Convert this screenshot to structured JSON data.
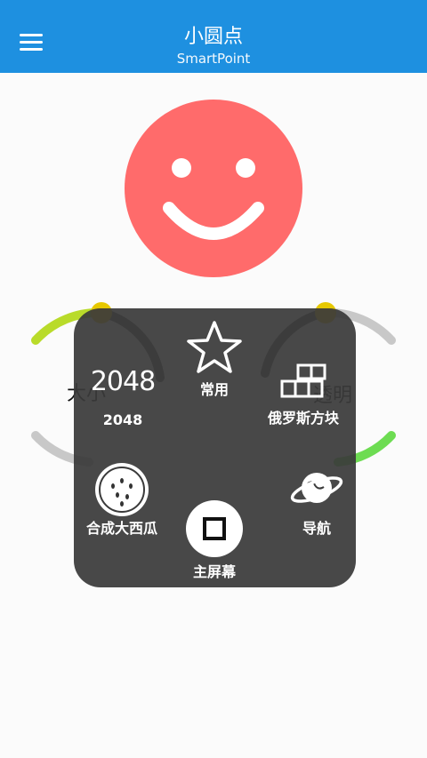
{
  "app_bar": {
    "title": "小圆点",
    "subtitle": "SmartPoint",
    "background": "#1e90e0"
  },
  "background_left_label": "大小",
  "background_right_label": "透明",
  "smiley_color": "#ff6b6b",
  "menu": {
    "items": [
      {
        "label": "常用",
        "icon": "star-icon"
      },
      {
        "label": "2048",
        "icon": "2048-icon",
        "icon_text": "2048"
      },
      {
        "label": "俄罗斯方块",
        "icon": "tetris-blocks-icon"
      },
      {
        "label": "合成大西瓜",
        "icon": "watermelon-icon"
      },
      {
        "label": "导航",
        "icon": "planet-icon"
      },
      {
        "label": "主屏幕",
        "icon": "home-button-icon"
      }
    ]
  }
}
